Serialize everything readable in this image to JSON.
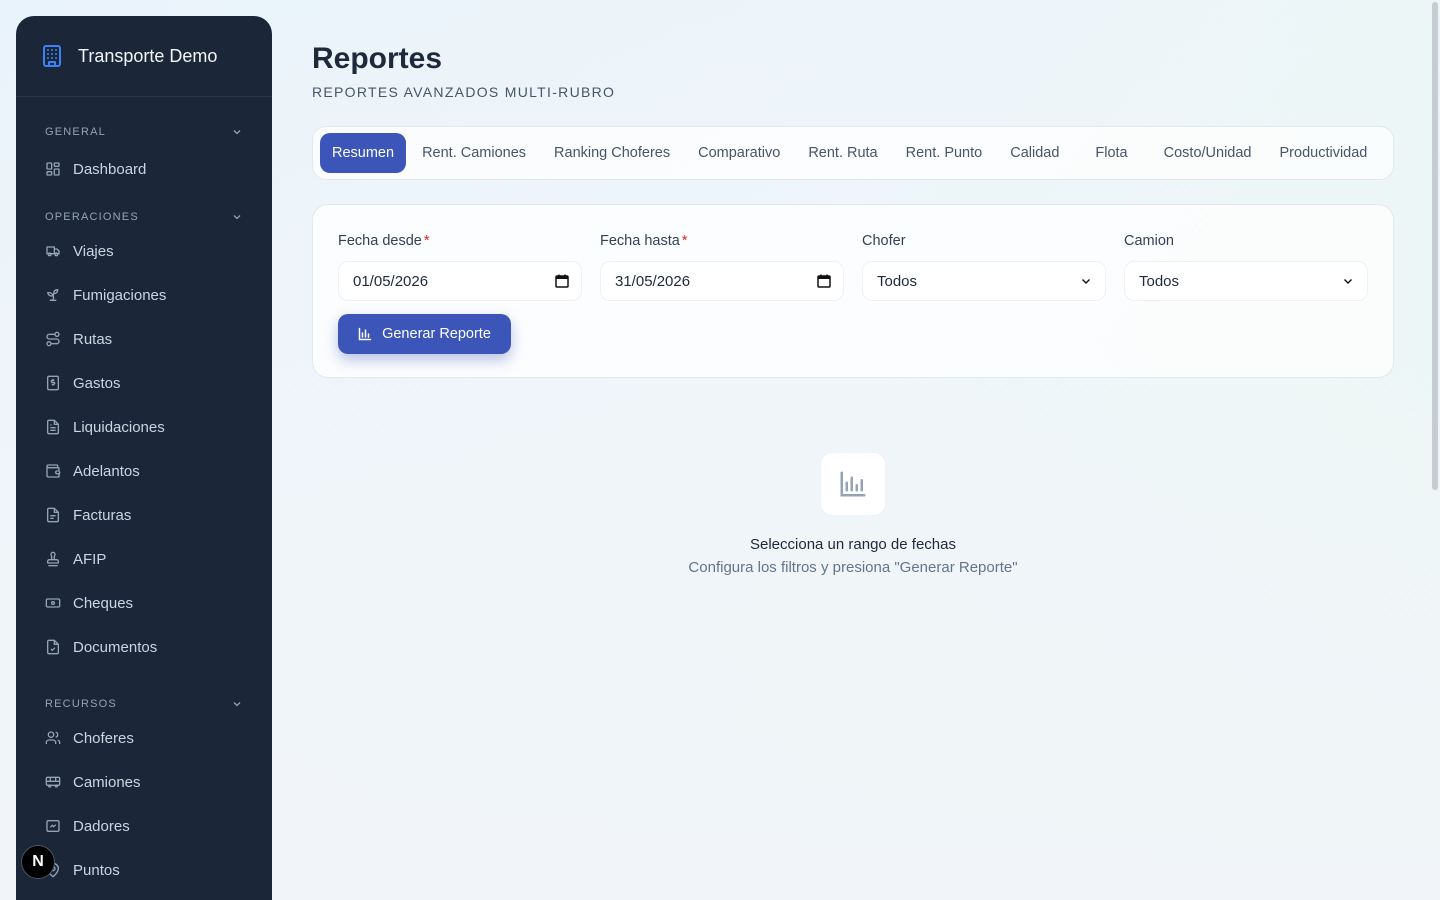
{
  "sidebar": {
    "brand": "Transporte Demo",
    "sections": [
      {
        "title": "GENERAL",
        "items": [
          {
            "label": "Dashboard",
            "icon": "grid-icon"
          }
        ]
      },
      {
        "title": "OPERACIONES",
        "items": [
          {
            "label": "Viajes",
            "icon": "truck-icon"
          },
          {
            "label": "Fumigaciones",
            "icon": "sprout-icon"
          },
          {
            "label": "Rutas",
            "icon": "route-icon"
          },
          {
            "label": "Gastos",
            "icon": "receipt-dollar-icon"
          },
          {
            "label": "Liquidaciones",
            "icon": "file-text-icon"
          },
          {
            "label": "Adelantos",
            "icon": "wallet-icon"
          },
          {
            "label": "Facturas",
            "icon": "file-invoice-icon"
          },
          {
            "label": "AFIP",
            "icon": "stamp-icon"
          },
          {
            "label": "Cheques",
            "icon": "banknote-icon"
          },
          {
            "label": "Documentos",
            "icon": "file-check-icon"
          }
        ]
      },
      {
        "title": "RECURSOS",
        "items": [
          {
            "label": "Choferes",
            "icon": "users-icon"
          },
          {
            "label": "Camiones",
            "icon": "bus-icon"
          },
          {
            "label": "Dadores",
            "icon": "handshake-icon"
          },
          {
            "label": "Puntos",
            "icon": "map-pin-icon"
          }
        ]
      }
    ],
    "badge": "N"
  },
  "header": {
    "title": "Reportes",
    "subtitle": "REPORTES AVANZADOS MULTI-RUBRO"
  },
  "tabs": [
    {
      "label": "Resumen",
      "active": true
    },
    {
      "label": "Rent. Camiones"
    },
    {
      "label": "Ranking Choferes"
    },
    {
      "label": "Comparativo"
    },
    {
      "label": "Rent. Ruta"
    },
    {
      "label": "Rent. Punto"
    },
    {
      "label": "Calidad"
    },
    {
      "label": "Flota"
    },
    {
      "label": "Costo/Unidad"
    },
    {
      "label": "Productividad"
    }
  ],
  "filters": {
    "fecha_desde": {
      "label": "Fecha desde",
      "required": "*",
      "value": "01/05/2026"
    },
    "fecha_hasta": {
      "label": "Fecha hasta",
      "required": "*",
      "value": "31/05/2026"
    },
    "chofer": {
      "label": "Chofer",
      "value": "Todos"
    },
    "camion": {
      "label": "Camion",
      "value": "Todos"
    },
    "generate_label": "Generar Reporte"
  },
  "empty_state": {
    "title": "Selecciona un rango de fechas",
    "description": "Configura los filtros y presiona \"Generar Reporte\""
  },
  "colors": {
    "accent": "#3b55b8",
    "sidebar_bg": "#1b2638",
    "brand_icon": "#3b82f6",
    "required": "#dc2626"
  }
}
